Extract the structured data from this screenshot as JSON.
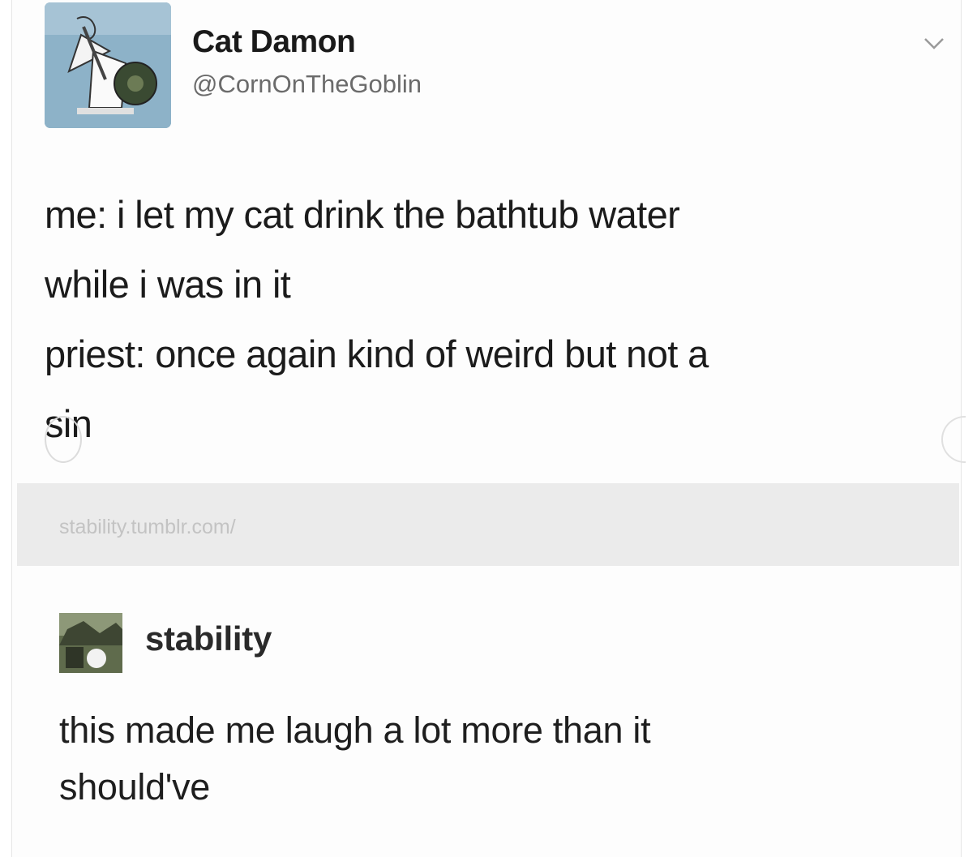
{
  "tweet": {
    "display_name": "Cat Damon",
    "handle": "@CornOnTheGoblin",
    "lines": [
      "me: i let my cat drink the bathtub water",
      "while i was in it",
      "priest: once again kind of weird but not a",
      "sin"
    ]
  },
  "source": {
    "link": "stability.tumblr.com/"
  },
  "reblog": {
    "username": "stability",
    "lines": [
      "this made me laugh a lot more than it",
      "should've"
    ]
  },
  "icons": {
    "menu": "chevron-down-icon"
  }
}
